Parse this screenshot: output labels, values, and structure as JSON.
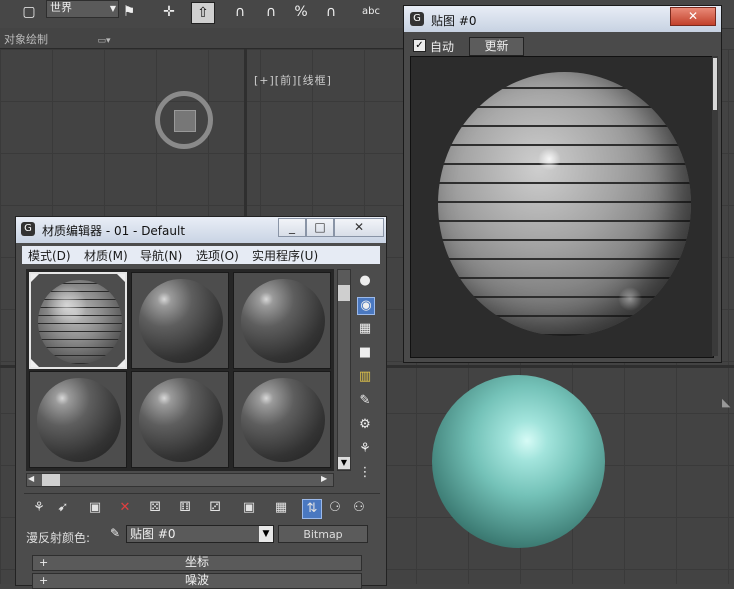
{
  "toolbar": {
    "coord_system": "世界",
    "icons": [
      "select-object-icon",
      "world-dropdown",
      "named-selection-icon",
      "move-icon",
      "select-and-manipulate-icon",
      "snap-3-icon",
      "angle-snap-icon",
      "percent-snap-icon",
      "spinner-snap-icon",
      "spell-check-icon"
    ]
  },
  "subbar": {
    "label": "对象绘制"
  },
  "viewport": {
    "label": "[+][前][线框]"
  },
  "material_editor": {
    "title": "材质编辑器 - 01 - Default",
    "menu": [
      "模式(D)",
      "材质(M)",
      "导航(N)",
      "选项(O)",
      "实用程序(U)"
    ],
    "window_buttons": [
      "_",
      "□",
      "✕"
    ],
    "slots": [
      {
        "name": "slot-1",
        "active": true,
        "type": "brick"
      },
      {
        "name": "slot-2",
        "active": false,
        "type": "standard"
      },
      {
        "name": "slot-3",
        "active": false,
        "type": "standard"
      },
      {
        "name": "slot-4",
        "active": false,
        "type": "standard"
      },
      {
        "name": "slot-5",
        "active": false,
        "type": "standard"
      },
      {
        "name": "slot-6",
        "active": false,
        "type": "standard"
      }
    ],
    "diffuse_label": "漫反射颜色:",
    "map_name": "贴图 #0",
    "map_type": "Bitmap",
    "rollouts": [
      "坐标",
      "噪波"
    ]
  },
  "map_window": {
    "title": "贴图 #0",
    "close": "✕",
    "auto_label": "自动",
    "auto_checked": true,
    "update_button": "更新"
  }
}
